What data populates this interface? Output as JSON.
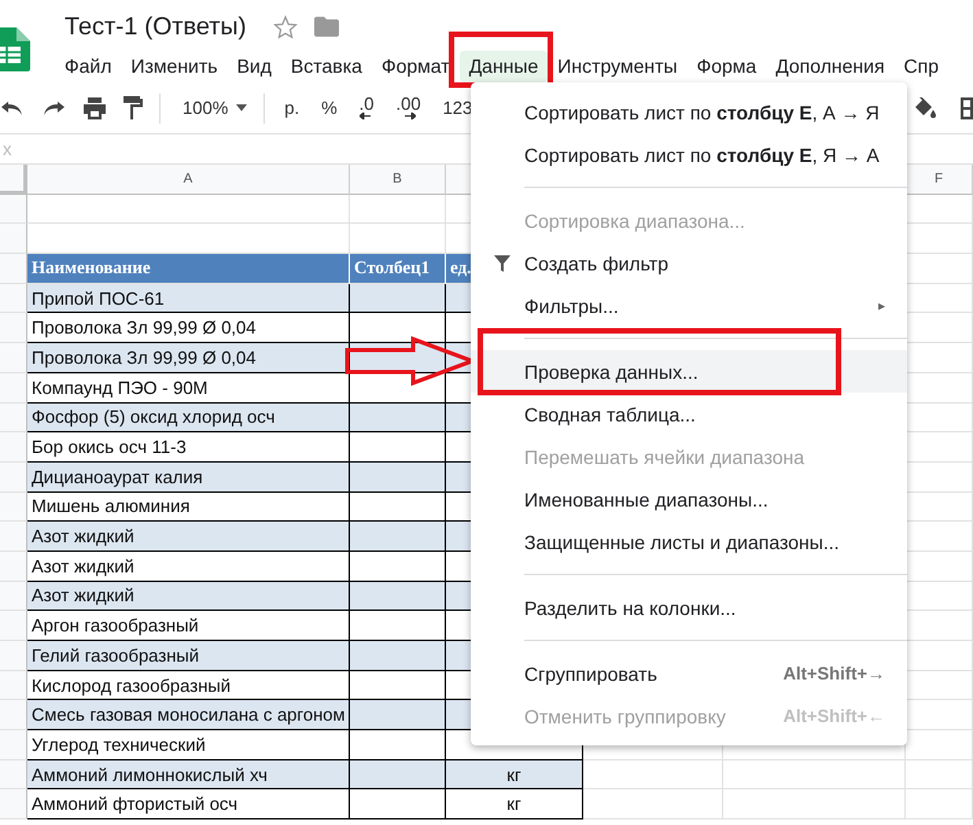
{
  "document": {
    "title": "Тест-1 (Ответы)",
    "starred": false
  },
  "menubar": [
    {
      "label": "Файл",
      "selected": false,
      "annotated": false
    },
    {
      "label": "Изменить",
      "selected": false,
      "annotated": false
    },
    {
      "label": "Вид",
      "selected": false,
      "annotated": false
    },
    {
      "label": "Вставка",
      "selected": false,
      "annotated": false
    },
    {
      "label": "Формат",
      "selected": false,
      "annotated": false
    },
    {
      "label": "Данные",
      "selected": true,
      "annotated": true
    },
    {
      "label": "Инструменты",
      "selected": false,
      "annotated": false
    },
    {
      "label": "Форма",
      "selected": false,
      "annotated": false
    },
    {
      "label": "Дополнения",
      "selected": false,
      "annotated": false
    },
    {
      "label": "Спр",
      "selected": false,
      "annotated": false
    }
  ],
  "toolbar": {
    "zoom": "100%",
    "currency": "р.",
    "percent": "%",
    "decrease_decimals": ".0",
    "increase_decimals": ".00",
    "number_format": "123"
  },
  "formula_bar": {
    "label": "x"
  },
  "column_headers": [
    "A",
    "B"
  ],
  "far_column_header": "F",
  "table": {
    "columns": [
      "Наименование",
      "Столбец1",
      "ед."
    ],
    "rows": [
      {
        "name": "Припой ПОС-61"
      },
      {
        "name": "Проволока Зл 99,99 Ø 0,04"
      },
      {
        "name": "Проволока Зл 99,99 Ø 0,04"
      },
      {
        "name": "Компаунд ПЭО - 90М"
      },
      {
        "name": "Фосфор (5) оксид хлорид осч"
      },
      {
        "name": "Бор окись осч 11-3"
      },
      {
        "name": "Дицианоаурат калия"
      },
      {
        "name": "Мишень алюминия"
      },
      {
        "name": "Азот жидкий"
      },
      {
        "name": "Азот жидкий"
      },
      {
        "name": "Азот жидкий"
      },
      {
        "name": "Аргон газообразный"
      },
      {
        "name": "Гелий газообразный"
      },
      {
        "name": "Кислород газообразный"
      },
      {
        "name": "Смесь газовая моносилана с аргоном"
      },
      {
        "name": "Углерод технический"
      },
      {
        "name": "Аммоний лимоннокислый хч",
        "unit": "кг"
      },
      {
        "name": "Аммоний фтористый осч",
        "unit": "кг"
      }
    ]
  },
  "data_menu": [
    {
      "kind": "item",
      "label": "Сортировать лист по **столбцу E**, А → Я",
      "disabled": false,
      "highlighted": false,
      "annotated": false
    },
    {
      "kind": "item",
      "label": "Сортировать лист по **столбцу E**, Я → А",
      "disabled": false,
      "highlighted": false,
      "annotated": false
    },
    {
      "kind": "divider"
    },
    {
      "kind": "item",
      "label": "Сортировка диапазона...",
      "disabled": true,
      "highlighted": false,
      "annotated": false
    },
    {
      "kind": "filter",
      "label": "Создать фильтр",
      "disabled": false,
      "highlighted": false,
      "annotated": false
    },
    {
      "kind": "submenu",
      "label": "Фильтры...",
      "arrow": "▸",
      "disabled": false,
      "highlighted": false,
      "annotated": false
    },
    {
      "kind": "divider"
    },
    {
      "kind": "item",
      "label": "Проверка данных...",
      "disabled": false,
      "highlighted": true,
      "annotated": true
    },
    {
      "kind": "item",
      "label": "Сводная таблица...",
      "disabled": false,
      "highlighted": false,
      "annotated": false
    },
    {
      "kind": "item",
      "label": "Перемешать ячейки диапазона",
      "disabled": true,
      "highlighted": false,
      "annotated": false
    },
    {
      "kind": "item",
      "label": "Именованные диапазоны...",
      "disabled": false,
      "highlighted": false,
      "annotated": false
    },
    {
      "kind": "item",
      "label": "Защищенные листы и диапазоны...",
      "disabled": false,
      "highlighted": false,
      "annotated": false
    },
    {
      "kind": "divider"
    },
    {
      "kind": "item",
      "label": "Разделить на колонки...",
      "disabled": false,
      "highlighted": false,
      "annotated": false
    },
    {
      "kind": "divider"
    },
    {
      "kind": "item",
      "label": "Сгруппировать",
      "shortcut": "Alt+Shift+→",
      "disabled": false,
      "highlighted": false,
      "annotated": false
    },
    {
      "kind": "item",
      "label": "Отменить группировку",
      "shortcut": "Alt+Shift+←",
      "disabled": true,
      "highlighted": false,
      "annotated": false
    }
  ],
  "arrow_annotation": true
}
